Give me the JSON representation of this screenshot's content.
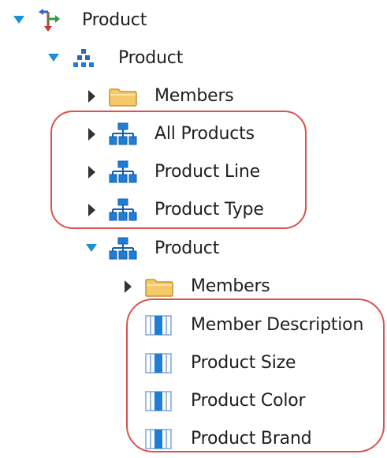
{
  "tree": {
    "dimension": {
      "label": "Product",
      "icon": "dimension-arrows-icon",
      "expanded": true
    },
    "hierarchy": {
      "label": "Product",
      "icon": "hierarchy-icon",
      "expanded": true,
      "members_label": "Members",
      "levels": [
        {
          "label": "All Products",
          "icon": "level-hierarchy-icon"
        },
        {
          "label": "Product Line",
          "icon": "level-hierarchy-icon"
        },
        {
          "label": "Product Type",
          "icon": "level-hierarchy-icon"
        }
      ],
      "level_product": {
        "label": "Product",
        "icon": "level-hierarchy-icon",
        "expanded": true,
        "members_label": "Members",
        "attributes": [
          {
            "label": "Member Description",
            "icon": "attribute-column-icon"
          },
          {
            "label": "Product Size",
            "icon": "attribute-column-icon"
          },
          {
            "label": "Product Color",
            "icon": "attribute-column-icon"
          },
          {
            "label": "Product Brand",
            "icon": "attribute-column-icon"
          }
        ]
      }
    }
  },
  "colors": {
    "highlight": "#d9534f",
    "accent_blue": "#1e7dd6",
    "folder": "#f5c96a",
    "expander": "#333333",
    "expander_open": "#1a8fd8"
  }
}
